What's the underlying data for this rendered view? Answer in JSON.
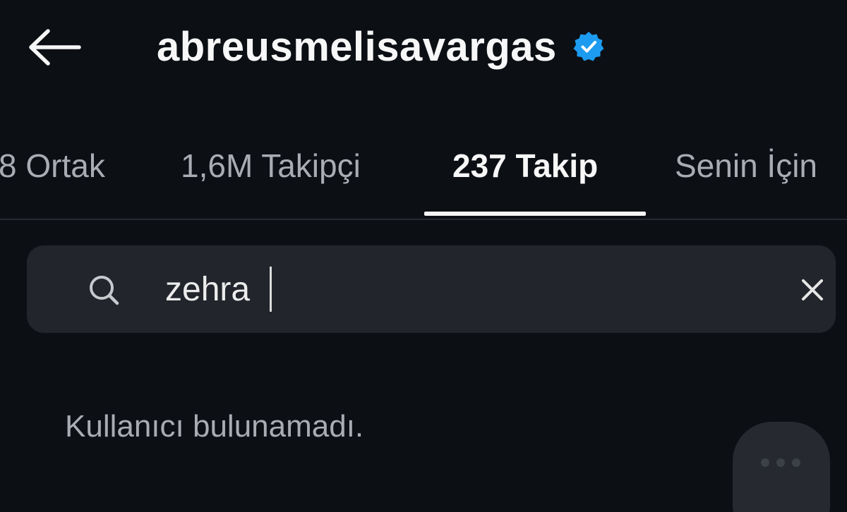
{
  "header": {
    "username": "abreusmelisavargas",
    "back_icon": "arrow-left-icon",
    "verified_icon": "verified-badge-icon",
    "verified_color": "#1d9bf0"
  },
  "tabs": [
    {
      "label": "8 Ortak",
      "active": false
    },
    {
      "label": "1,6M Takipçi",
      "active": false
    },
    {
      "label": "237 Takip",
      "active": true
    },
    {
      "label": "Senin İçin",
      "active": false
    }
  ],
  "search": {
    "value": "zehra",
    "icon": "search-icon",
    "clear_icon": "close-icon"
  },
  "empty_state": {
    "message": "Kullanıcı bulunamadı."
  },
  "colors": {
    "background": "#0c0f14",
    "search_bg": "#22252b",
    "muted_text": "#a9adb3",
    "active_text": "#f7f7f7"
  }
}
